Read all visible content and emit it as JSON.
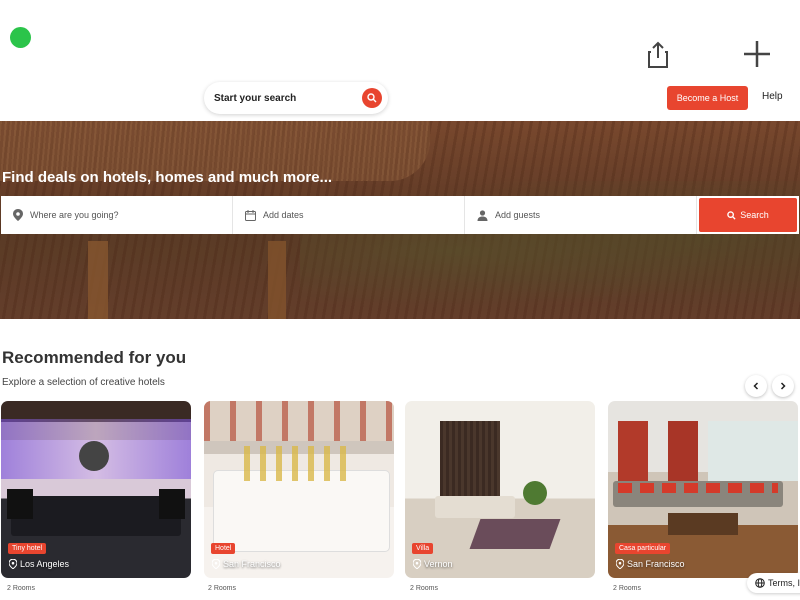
{
  "header": {
    "search_placeholder": "Start your search",
    "become_host_label": "Become a Host",
    "help_label": "Help"
  },
  "hero": {
    "headline": "Find deals on hotels, homes and much more...",
    "destination_placeholder": "Where are you going?",
    "dates_placeholder": "Add dates",
    "guests_placeholder": "Add guests",
    "search_button_label": "Search"
  },
  "recommended": {
    "title": "Recommended for you",
    "subtitle": "Explore a selection of creative hotels",
    "cards": [
      {
        "badge": "Tiny hotel",
        "location": "Los Angeles",
        "rooms": "2 Rooms"
      },
      {
        "badge": "Hotel",
        "location": "San Francisco",
        "rooms": "2 Rooms"
      },
      {
        "badge": "Villa",
        "location": "Vernon",
        "rooms": "2 Rooms"
      },
      {
        "badge": "Casa particular",
        "location": "San Francisco",
        "rooms": "2 Rooms"
      }
    ]
  },
  "footer": {
    "terms_label": "Terms, I"
  },
  "colors": {
    "accent": "#e8452f",
    "status_dot": "#2bc44a"
  },
  "icons": [
    "share-icon",
    "plus-icon",
    "search-icon",
    "location-pin-icon",
    "calendar-icon",
    "user-icon",
    "chevron-left-icon",
    "chevron-right-icon",
    "globe-icon"
  ]
}
